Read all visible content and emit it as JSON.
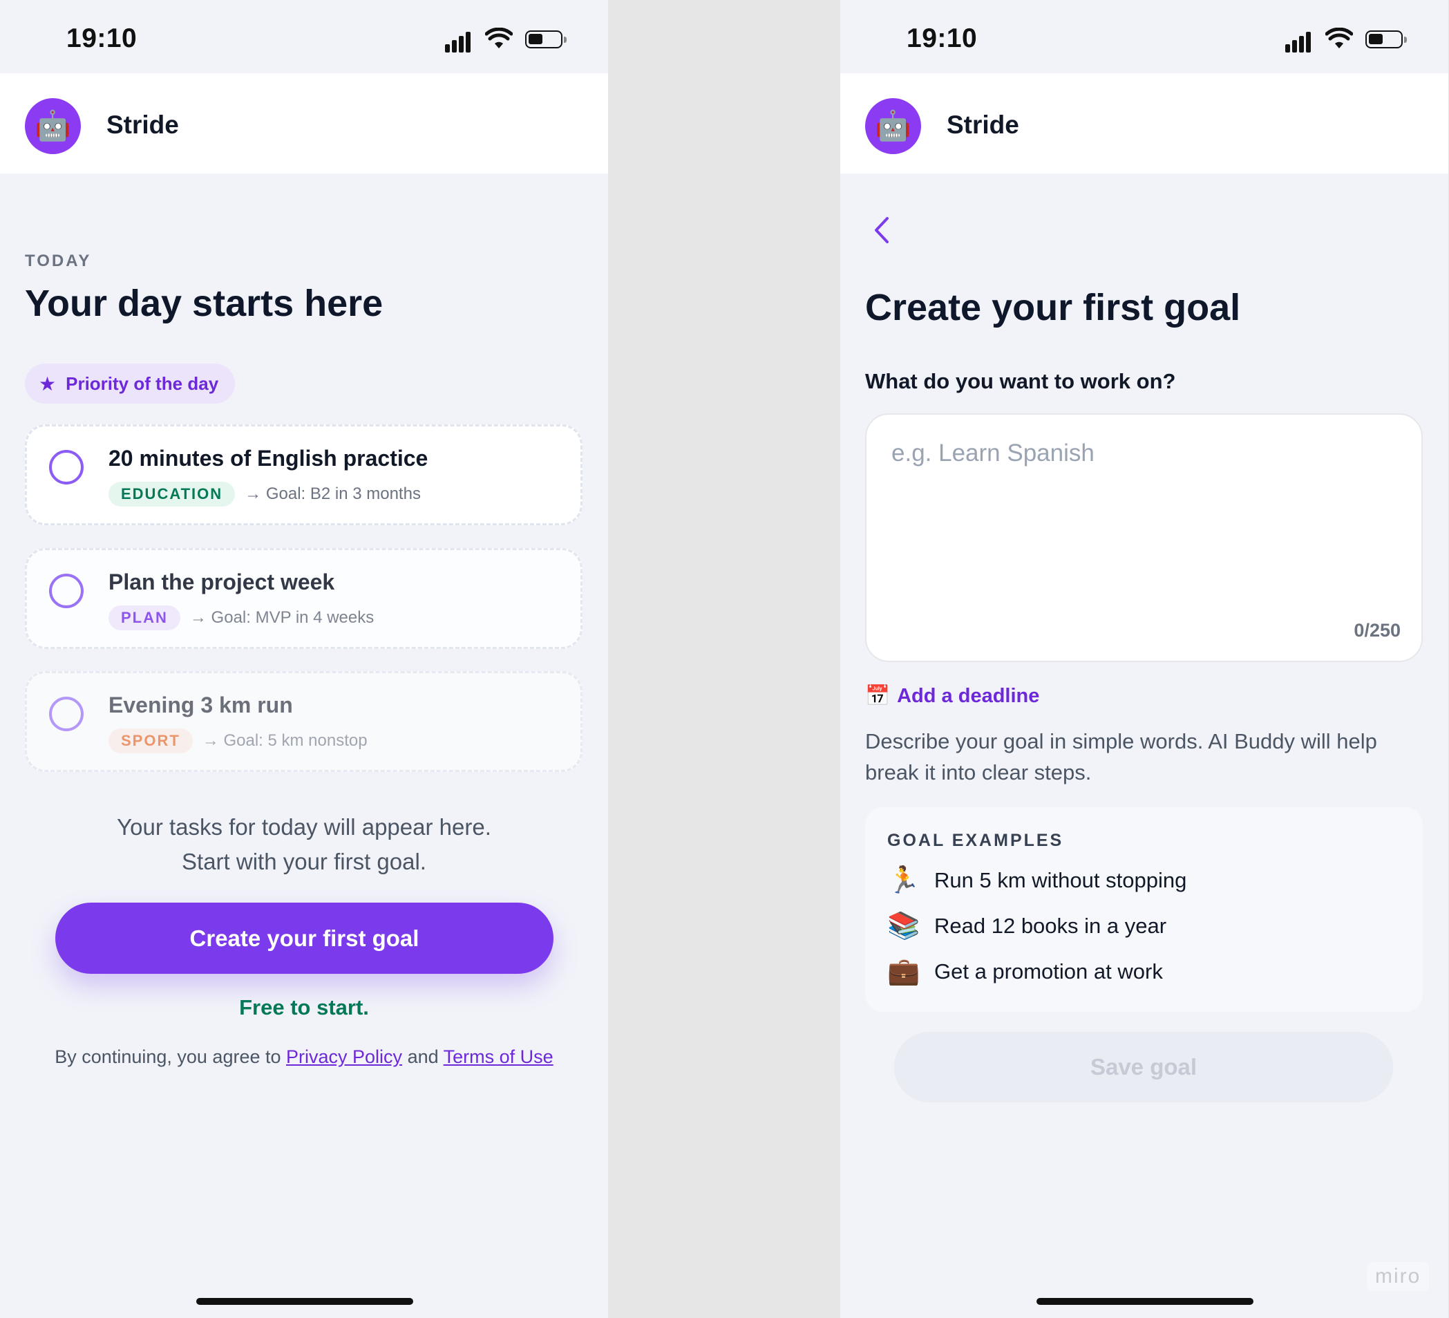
{
  "status": {
    "time": "19:10"
  },
  "app": {
    "name": "Stride",
    "avatar_icon": "robot-icon"
  },
  "today_screen": {
    "section_label": "TODAY",
    "title": "Your day starts here",
    "priority_badge": "Priority of the day",
    "tasks": [
      {
        "title": "20 minutes of English practice",
        "tag": "EDUCATION",
        "tag_bg": "#e4f6ee",
        "tag_color": "#047857",
        "goal": "→ Goal: B2 in 3 months"
      },
      {
        "title": "Plan the project week",
        "tag": "PLAN",
        "tag_bg": "#efe8fc",
        "tag_color": "#7c3aed",
        "goal": "→ Goal: MVP in 4 weeks"
      },
      {
        "title": "Evening 3 km run",
        "tag": "SPORT",
        "tag_bg": "#fdeee6",
        "tag_color": "#ea580c",
        "goal": "→ Goal: 5 km nonstop"
      }
    ],
    "empty_line1": "Your tasks for today will appear here.",
    "empty_line2": "Start with your first goal.",
    "cta": "Create your first goal",
    "free_note": "Free to start.",
    "legal_prefix": "By continuing, you agree to",
    "privacy_link": "Privacy Policy",
    "legal_and": "and",
    "terms_link": "Terms of Use"
  },
  "create_screen": {
    "title": "Create your first goal",
    "question": "What do you want to work on?",
    "placeholder": "e.g. Learn Spanish",
    "counter": "0/250",
    "deadline_icon": "📅",
    "deadline_link": "Add a deadline",
    "help_text": "Describe your goal in simple words. AI Buddy will help break it into clear steps.",
    "examples_label": "GOAL EXAMPLES",
    "examples": [
      {
        "icon": "🏃",
        "text": "Run 5 km without stopping"
      },
      {
        "icon": "📚",
        "text": "Read 12 books in a year"
      },
      {
        "icon": "💼",
        "text": "Get a promotion at work"
      }
    ],
    "save_button": "Save goal"
  },
  "watermark": "miro",
  "colors": {
    "accent": "#7c3aed",
    "success": "#047857"
  }
}
